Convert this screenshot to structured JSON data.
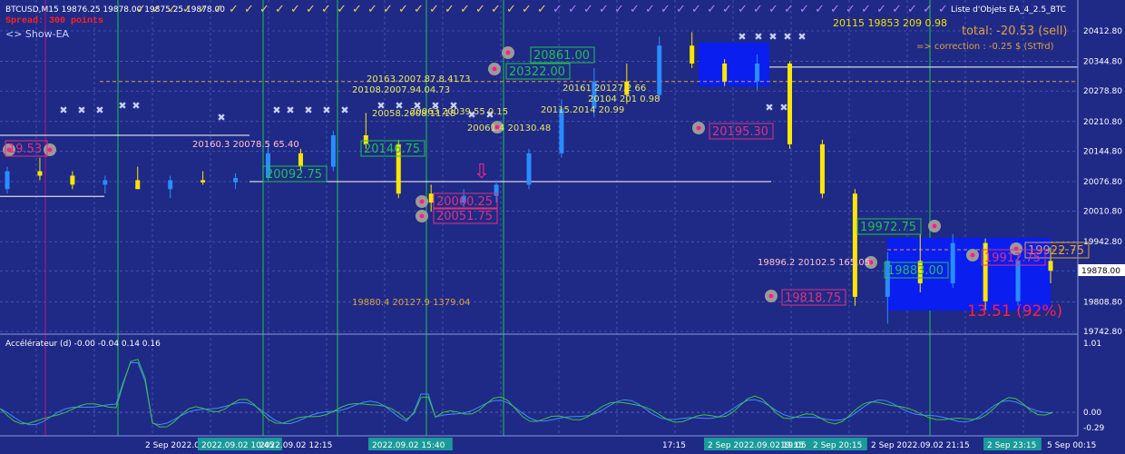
{
  "window": {
    "symbol_line": "BTCUSD,M15  19876.25 19878.00 19875.25 19878.00",
    "spread": "Spread: 300 points",
    "show_ea": "<> Show-EA",
    "objects_label": "Liste d'Objets EA_4_2.5_BTC"
  },
  "overlay": {
    "total": "total: -20.53 (sell)",
    "correction": "=> correction : -0.25 $ (StTrd)",
    "pct": "13.51 (92%)",
    "info_top_right": "20115 19853 209 0.98",
    "texts": [
      "20163.2007.87.8.4173",
      "20108.2007.94.04.73",
      "20160.3 20078.5 65.40",
      "19896.2 20102.5 165.05",
      "19880.4 20127.9 1379.04",
      "20058.2008.11.18",
      "20063 20039 55 0.15",
      "20061.4 20130.48",
      "20115.2014 20.99",
      "20104 201 0.98",
      "20161 20127.2 66"
    ],
    "boxes": [
      {
        "text": "20861.00",
        "color": "#20c050"
      },
      {
        "text": "20322.00",
        "color": "#20c050"
      },
      {
        "text": "20146.75",
        "color": "#20c050"
      },
      {
        "text": "20092.75",
        "color": "#20c050"
      },
      {
        "text": "19972.75",
        "color": "#20c050"
      },
      {
        "text": "19883.00",
        "color": "#20c050"
      },
      {
        "text": "20195.30",
        "color": "#e03080"
      },
      {
        "text": "19818.75",
        "color": "#e03080"
      },
      {
        "text": "20060.25",
        "color": "#e03080"
      },
      {
        "text": "20051.75",
        "color": "#e03080"
      },
      {
        "text": "19922.75",
        "color": "#e0a040"
      },
      {
        "text": "19912.75",
        "color": "#e03080"
      },
      {
        "text": "19.53",
        "color": "#e03080"
      }
    ]
  },
  "indicator": {
    "label": "Accélérateur (d) -0.00 -0.04 0.14 0.16",
    "ticks": [
      "1.01",
      "0.00",
      "-0.29"
    ]
  },
  "chart_data": {
    "type": "candlestick",
    "title": "BTCUSD,M15",
    "ylim": [
      19742.8,
      20412.8
    ],
    "yticks": [
      "20412.80",
      "20344.80",
      "20278.80",
      "20210.80",
      "20144.80",
      "20076.80",
      "20010.80",
      "19942.80",
      "19878.00",
      "19808.80",
      "19742.80"
    ],
    "current_price": "19878.00",
    "xticks": [
      "2 Sep 2022.09.02 05:15",
      "2022.09.02 10:45",
      "2022.09.02 12:15",
      "2022.09.02 15:40",
      "17:15",
      "2 Sep 2022.09.02 19:05",
      "19:15",
      "2 Sep 20:15",
      "2 Sep 2022.09.02 21:15",
      "2 Sep 23:15",
      "5 Sep 00:15"
    ],
    "ohlc_samples": [
      {
        "o": 20060,
        "h": 20110,
        "l": 20050,
        "c": 20100
      },
      {
        "o": 20100,
        "h": 20130,
        "l": 20080,
        "c": 20090
      },
      {
        "o": 20090,
        "h": 20100,
        "l": 20060,
        "c": 20070
      },
      {
        "o": 20070,
        "h": 20090,
        "l": 20050,
        "c": 20080
      },
      {
        "o": 20080,
        "h": 20110,
        "l": 20060,
        "c": 20060
      },
      {
        "o": 20060,
        "h": 20090,
        "l": 20040,
        "c": 20080
      },
      {
        "o": 20080,
        "h": 20100,
        "l": 20070,
        "c": 20075
      },
      {
        "o": 20075,
        "h": 20095,
        "l": 20060,
        "c": 20085
      },
      {
        "o": 20085,
        "h": 20160,
        "l": 20080,
        "c": 20140
      },
      {
        "o": 20140,
        "h": 20150,
        "l": 20100,
        "c": 20110
      },
      {
        "o": 20110,
        "h": 20190,
        "l": 20100,
        "c": 20180
      },
      {
        "o": 20180,
        "h": 20230,
        "l": 20150,
        "c": 20160
      },
      {
        "o": 20160,
        "h": 20170,
        "l": 20040,
        "c": 20050
      },
      {
        "o": 20050,
        "h": 20070,
        "l": 20010,
        "c": 20030
      },
      {
        "o": 20030,
        "h": 20060,
        "l": 20020,
        "c": 20045
      },
      {
        "o": 20045,
        "h": 20080,
        "l": 20030,
        "c": 20070
      },
      {
        "o": 20070,
        "h": 20150,
        "l": 20060,
        "c": 20140
      },
      {
        "o": 20140,
        "h": 20260,
        "l": 20130,
        "c": 20240
      },
      {
        "o": 20240,
        "h": 20330,
        "l": 20220,
        "c": 20300
      },
      {
        "o": 20300,
        "h": 20340,
        "l": 20250,
        "c": 20270
      },
      {
        "o": 20270,
        "h": 20400,
        "l": 20260,
        "c": 20380
      },
      {
        "o": 20380,
        "h": 20410,
        "l": 20330,
        "c": 20340
      },
      {
        "o": 20340,
        "h": 20350,
        "l": 20290,
        "c": 20300
      },
      {
        "o": 20300,
        "h": 20360,
        "l": 20280,
        "c": 20340
      },
      {
        "o": 20340,
        "h": 20345,
        "l": 20150,
        "c": 20160
      },
      {
        "o": 20160,
        "h": 20170,
        "l": 20040,
        "c": 20050
      },
      {
        "o": 20050,
        "h": 20060,
        "l": 19800,
        "c": 19820
      },
      {
        "o": 19820,
        "h": 19920,
        "l": 19760,
        "c": 19900
      },
      {
        "o": 19900,
        "h": 19960,
        "l": 19830,
        "c": 19850
      },
      {
        "o": 19850,
        "h": 19960,
        "l": 19840,
        "c": 19940
      },
      {
        "o": 19940,
        "h": 19950,
        "l": 19790,
        "c": 19810
      },
      {
        "o": 19810,
        "h": 19920,
        "l": 19800,
        "c": 19900
      },
      {
        "o": 19900,
        "h": 19930,
        "l": 19850,
        "c": 19878
      }
    ]
  },
  "colors": {
    "background": "#1f2a86",
    "grid": "#5b6bc0",
    "bull": "#2a8cff",
    "bear": "#ffe600",
    "box_blue": "#0a1ef0"
  }
}
